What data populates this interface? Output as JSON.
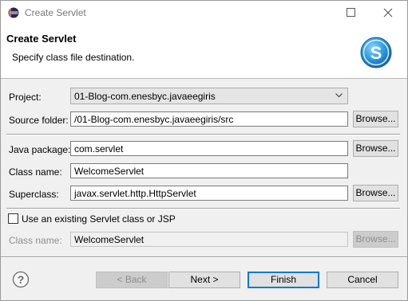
{
  "window": {
    "title": "Create Servlet"
  },
  "banner": {
    "title": "Create Servlet",
    "message": "Specify class file destination."
  },
  "form": {
    "project_label": "Project:",
    "project_value": "01-Blog-com.enesbyc.javaeegiris",
    "source_folder_label": "Source folder:",
    "source_folder_value": "/01-Blog-com.enesbyc.javaeegiris/src",
    "java_package_label": "Java package:",
    "java_package_value": "com.servlet",
    "class_name_label": "Class name:",
    "class_name_value": "WelcomeServlet",
    "superclass_label": "Superclass:",
    "superclass_value": "javax.servlet.http.HttpServlet",
    "browse_label": "Browse...",
    "use_existing_label": "Use an existing Servlet class or JSP",
    "use_existing_checked": false,
    "existing_class_name_label": "Class name:",
    "existing_class_name_value": "WelcomeServlet"
  },
  "footer": {
    "back_label": "< Back",
    "next_label": "Next >",
    "finish_label": "Finish",
    "cancel_label": "Cancel"
  },
  "icons": {
    "app": "eclipse-icon",
    "banner": "servlet-s-logo-icon",
    "help": "help-icon"
  },
  "colors": {
    "accent": "#0078d7",
    "logo": "#2e9de0"
  }
}
